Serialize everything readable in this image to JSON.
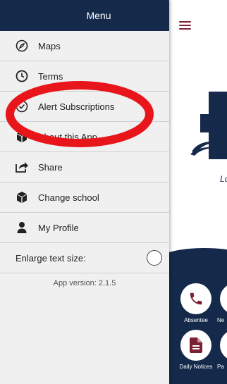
{
  "menu": {
    "title": "Menu",
    "items": [
      {
        "label": "Maps",
        "icon": "compass-icon"
      },
      {
        "label": "Terms",
        "icon": "clock-icon"
      },
      {
        "label": "Alert Subscriptions",
        "icon": "check-circle-icon"
      },
      {
        "label": "About this App",
        "icon": "cube-icon"
      },
      {
        "label": "Share",
        "icon": "share-icon"
      },
      {
        "label": "Change school",
        "icon": "cube-icon"
      },
      {
        "label": "My Profile",
        "icon": "user-icon"
      }
    ],
    "enlarge_label": "Enlarge text size:",
    "version": "App version: 2.1.5"
  },
  "app": {
    "hero_text": "Lo",
    "tiles": [
      {
        "label": "Absentee",
        "icon": "phone-icon"
      },
      {
        "label": "Ne",
        "icon": "partial-tile-icon"
      },
      {
        "label": "Daily Notices",
        "icon": "document-icon"
      },
      {
        "label": "Pa",
        "icon": "partial-tile-icon"
      }
    ]
  },
  "colors": {
    "navy": "#15294b",
    "maroon": "#7b2134",
    "annotation_red": "#e8161b"
  }
}
